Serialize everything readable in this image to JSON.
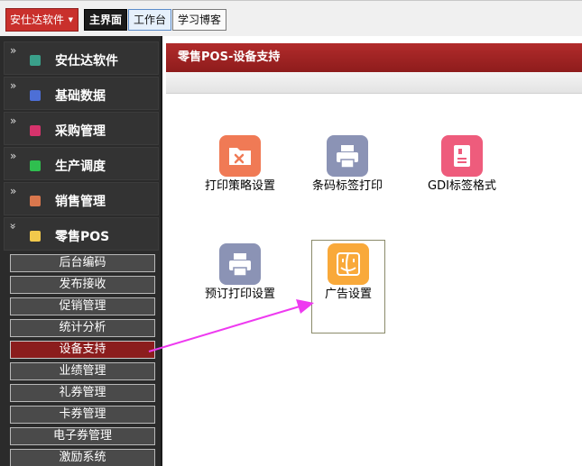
{
  "topbar": {
    "app_menu_label": "安仕达软件",
    "tabs": [
      {
        "label": "主界面",
        "active": true
      },
      {
        "label": "工作台",
        "active": false
      },
      {
        "label": "学习博客",
        "active": false
      }
    ]
  },
  "sidebar": {
    "sections": [
      {
        "label": "安仕达软件",
        "icon": "app-icon",
        "color": "#3aa08a"
      },
      {
        "label": "基础数据",
        "icon": "data-icon",
        "color": "#4d6fd6"
      },
      {
        "label": "采购管理",
        "icon": "purchase-icon",
        "color": "#d6336c"
      },
      {
        "label": "生产调度",
        "icon": "production-icon",
        "color": "#2fbf4f"
      },
      {
        "label": "销售管理",
        "icon": "sales-icon",
        "color": "#d9774d"
      },
      {
        "label": "零售POS",
        "icon": "pos-icon",
        "color": "#f2c94c"
      }
    ],
    "pos_items": [
      {
        "label": "后台编码",
        "active": false
      },
      {
        "label": "发布接收",
        "active": false
      },
      {
        "label": "促销管理",
        "active": false
      },
      {
        "label": "统计分析",
        "active": false
      },
      {
        "label": "设备支持",
        "active": true
      },
      {
        "label": "业绩管理",
        "active": false
      },
      {
        "label": "礼券管理",
        "active": false
      },
      {
        "label": "卡券管理",
        "active": false
      },
      {
        "label": "电子券管理",
        "active": false
      },
      {
        "label": "激励系统",
        "active": false
      }
    ]
  },
  "main": {
    "header_title": "零售POS-设备支持",
    "items": [
      {
        "label": "打印策略设置",
        "icon": "folder-tools-icon",
        "color": "#f07a55"
      },
      {
        "label": "条码标签打印",
        "icon": "printer-icon",
        "color": "#8b93b5"
      },
      {
        "label": "GDI标签格式",
        "icon": "label-doc-icon",
        "color": "#ee5c7c"
      },
      {
        "label": "预订打印设置",
        "icon": "printer-icon",
        "color": "#8b93b5"
      },
      {
        "label": "广告设置",
        "icon": "finder-face-icon",
        "color": "#f9a93a"
      }
    ]
  },
  "colors": {
    "accent_red": "#8e1c1c",
    "annotation_arrow": "#ee3af0"
  }
}
